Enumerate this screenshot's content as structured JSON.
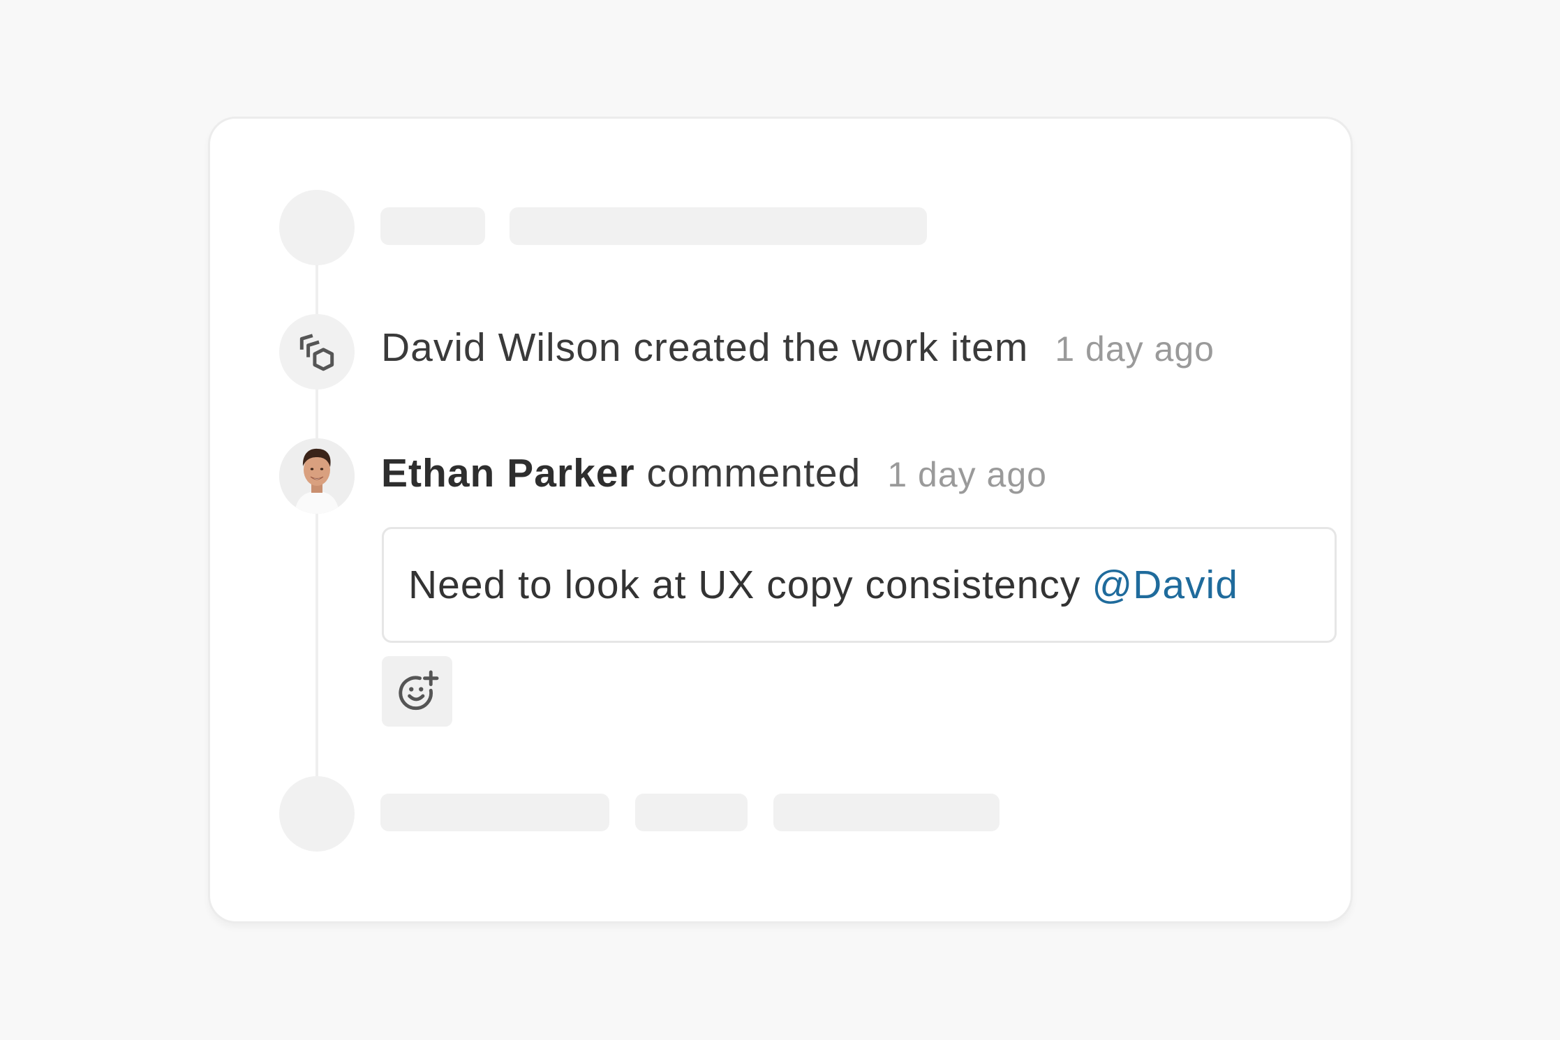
{
  "colors": {
    "page_background": "#f8f8f8",
    "card_background": "#ffffff",
    "skeleton": "#f1f1f1",
    "mention": "#1f6b9c",
    "muted_text": "#9a9a9a"
  },
  "activity": {
    "created_event": {
      "text": "David Wilson created the work item",
      "time": "1 day ago",
      "icon": "work-item-icon"
    },
    "comment_event": {
      "author": "Ethan Parker",
      "action": "commented",
      "time": "1 day ago",
      "body": "Need to look at UX copy consistency",
      "mention": "@David",
      "reaction_icon": "emoji-add-icon"
    }
  }
}
